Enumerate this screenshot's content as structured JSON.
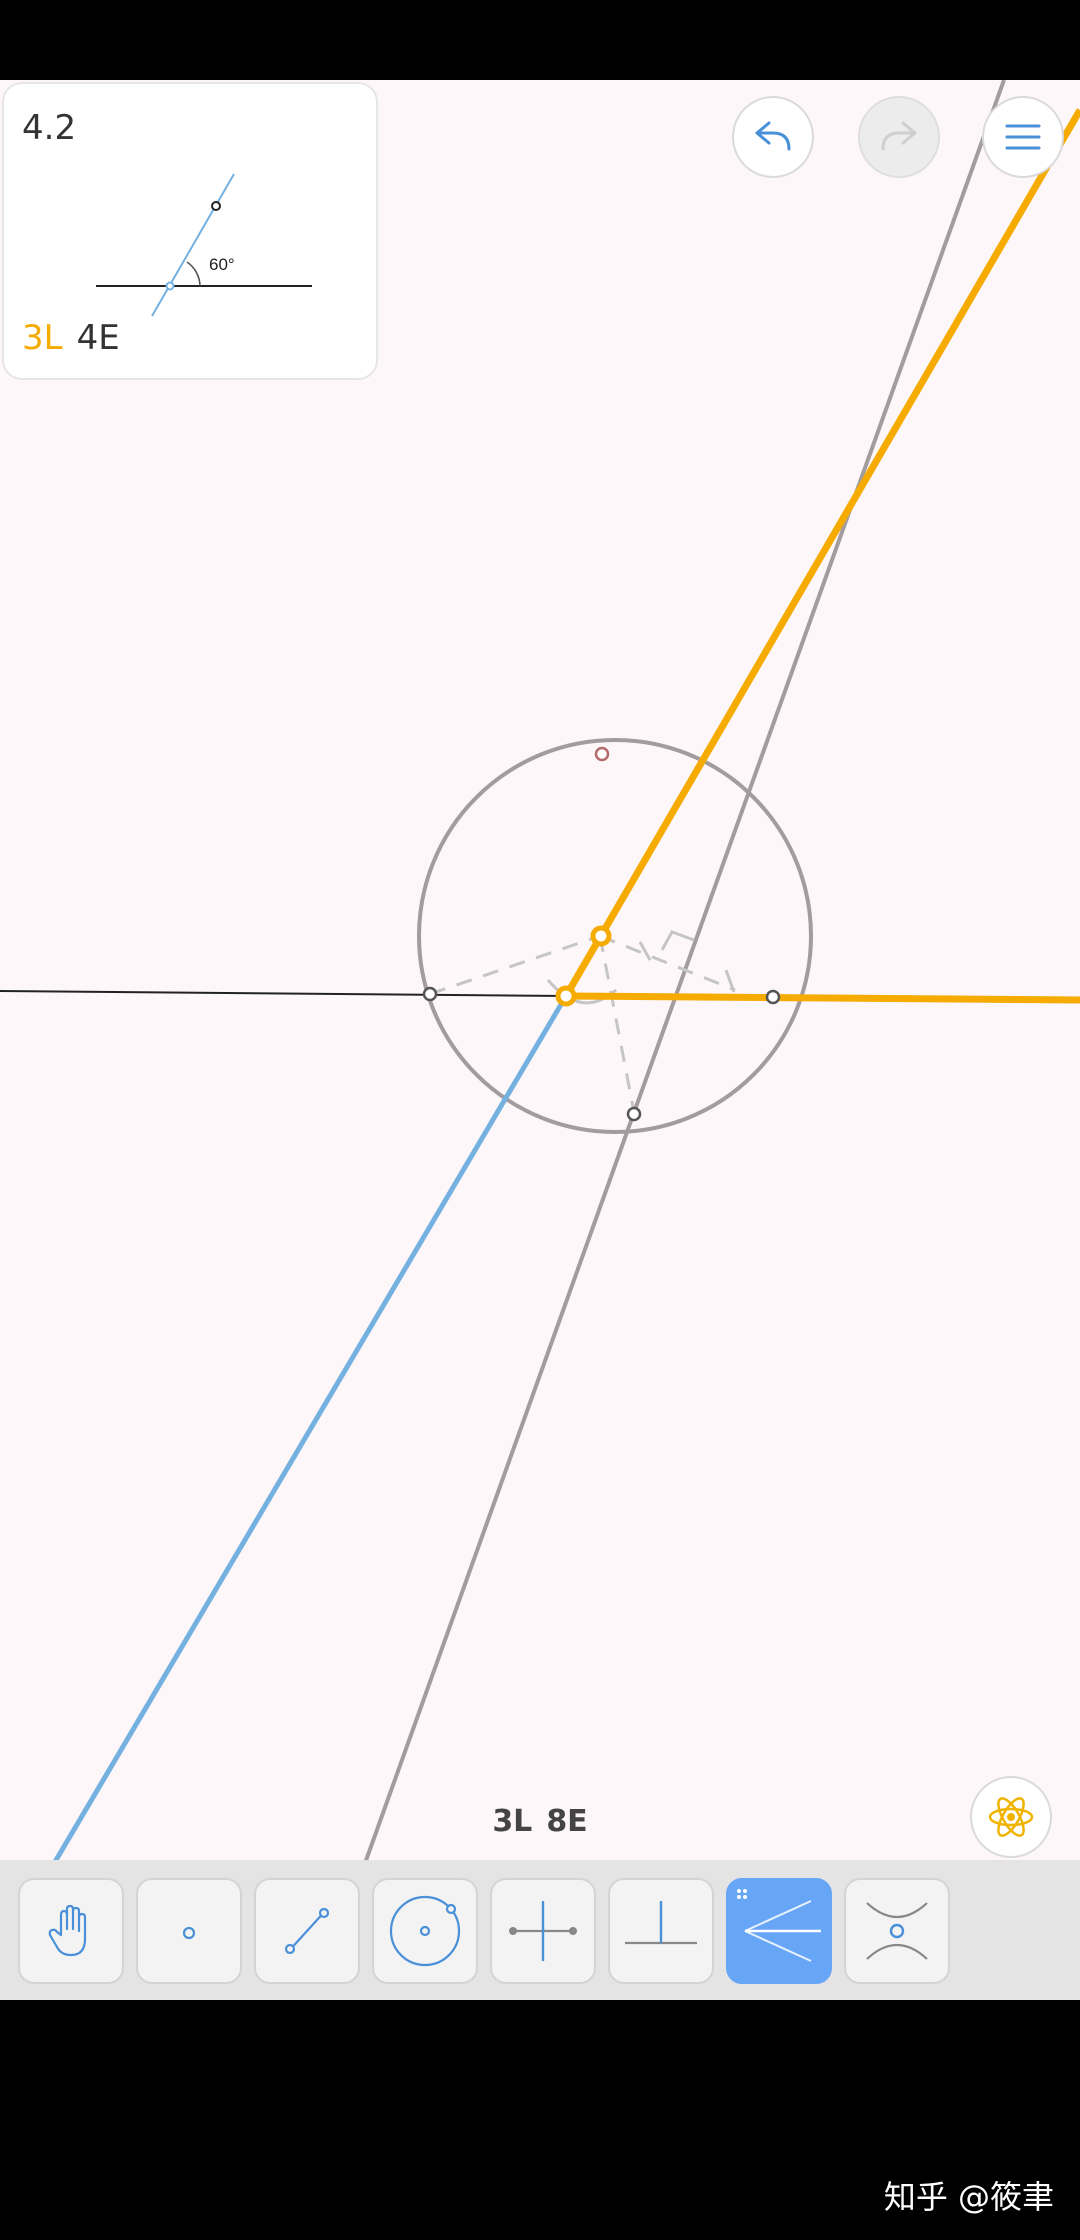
{
  "level": {
    "number": "4.2",
    "angle_label": "60°",
    "goal_l": "3L",
    "goal_e": "4E"
  },
  "header": {
    "undo_icon": "undo-arrow-icon",
    "redo_icon": "redo-arrow-icon",
    "menu_icon": "hamburger-menu-icon"
  },
  "hint": {
    "icon": "atom-icon"
  },
  "counter": {
    "l": "3L",
    "e": "8E"
  },
  "toolbar": {
    "tools": [
      {
        "name": "move-tool",
        "icon": "hand-icon"
      },
      {
        "name": "point-tool",
        "icon": "point-icon"
      },
      {
        "name": "line-tool",
        "icon": "line-icon"
      },
      {
        "name": "circle-tool",
        "icon": "circle-icon"
      },
      {
        "name": "perpendicular-bisector-tool",
        "icon": "perpendicular-bisector-icon"
      },
      {
        "name": "perpendicular-tool",
        "icon": "perpendicular-icon"
      },
      {
        "name": "angle-bisector-tool",
        "icon": "angle-bisector-icon"
      },
      {
        "name": "intersection-tool",
        "icon": "intersection-icon"
      }
    ],
    "active_tool": "angle-bisector-tool"
  },
  "watermark": "知乎 @筱聿",
  "colors": {
    "accent_yellow": "#f5ab00",
    "line_blue": "#74b0e0",
    "construction_grey": "#a39c9f",
    "active_tool": "#67a6f7",
    "canvas_background": "#fdf7fa"
  }
}
